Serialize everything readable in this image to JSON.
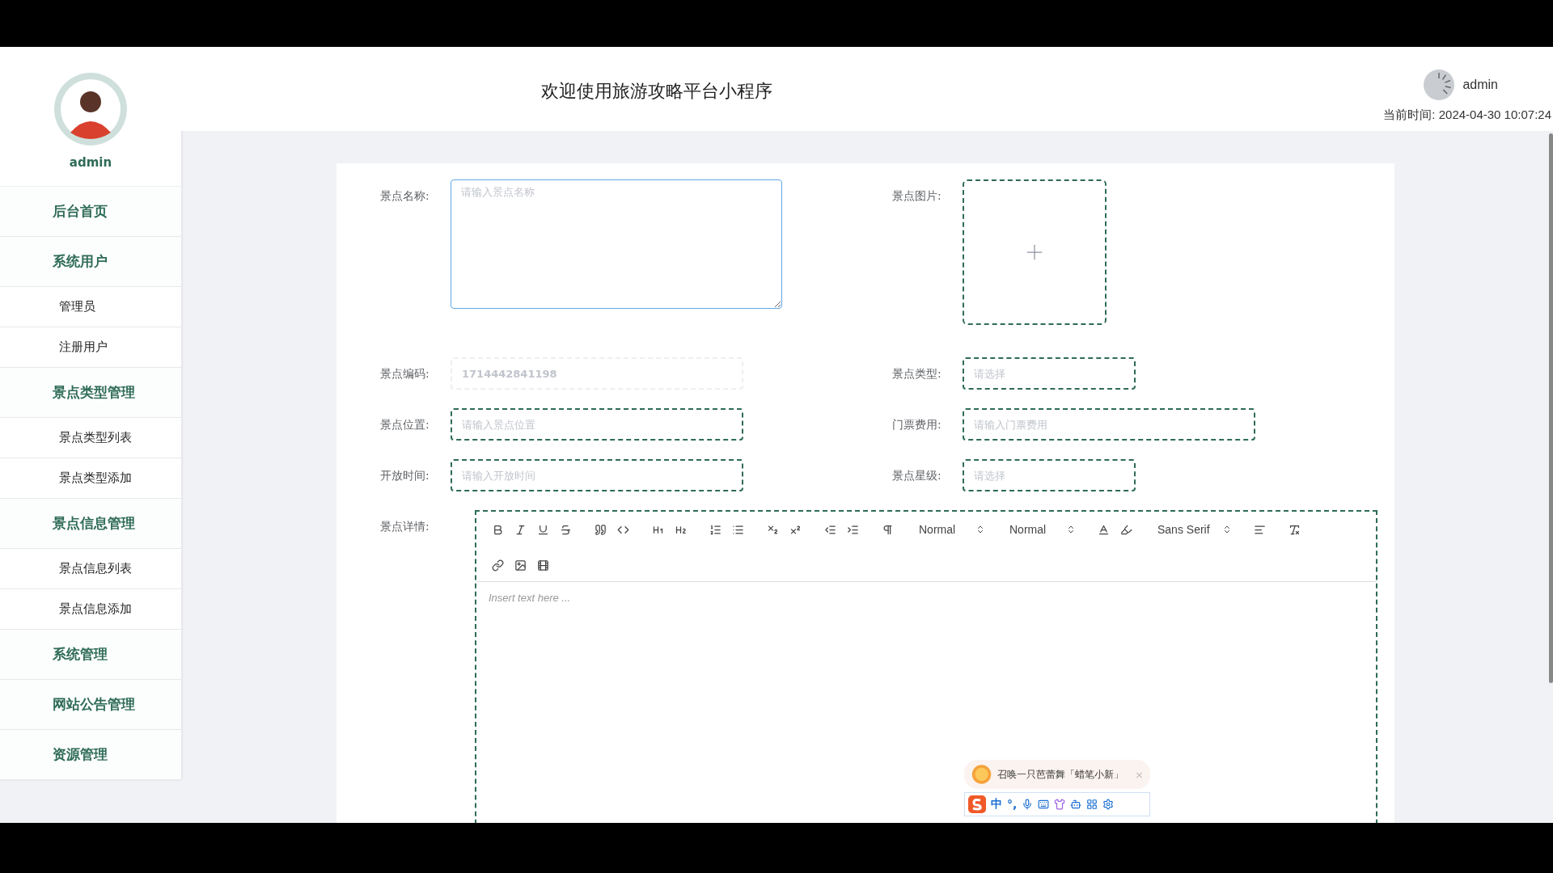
{
  "sidebar": {
    "username": "admin",
    "items": [
      {
        "label": "后台首页",
        "kind": "group"
      },
      {
        "label": "系统用户",
        "kind": "group"
      },
      {
        "label": "管理员",
        "kind": "sub"
      },
      {
        "label": "注册用户",
        "kind": "sub"
      },
      {
        "label": "景点类型管理",
        "kind": "group"
      },
      {
        "label": "景点类型列表",
        "kind": "sub"
      },
      {
        "label": "景点类型添加",
        "kind": "sub"
      },
      {
        "label": "景点信息管理",
        "kind": "group"
      },
      {
        "label": "景点信息列表",
        "kind": "sub"
      },
      {
        "label": "景点信息添加",
        "kind": "sub"
      },
      {
        "label": "系统管理",
        "kind": "group"
      },
      {
        "label": "网站公告管理",
        "kind": "group"
      },
      {
        "label": "资源管理",
        "kind": "group"
      }
    ]
  },
  "header": {
    "title": "欢迎使用旅游攻略平台小程序",
    "user": "admin",
    "time_label": "当前时间:",
    "time": "2024-04-30 10:07:24"
  },
  "form": {
    "fields": [
      {
        "label": "景点名称:",
        "kind": "textarea",
        "placeholder": "请输入景点名称",
        "focused": true
      },
      {
        "label": "景点图片:",
        "kind": "upload"
      },
      {
        "label": "景点编码:",
        "kind": "input",
        "value": "1714442841198",
        "disabled": true
      },
      {
        "label": "景点类型:",
        "kind": "select",
        "placeholder": "请选择"
      },
      {
        "label": "景点位置:",
        "kind": "input",
        "placeholder": "请输入景点位置"
      },
      {
        "label": "门票费用:",
        "kind": "input",
        "placeholder": "请输入门票费用"
      },
      {
        "label": "开放时间:",
        "kind": "input",
        "placeholder": "请输入开放时间"
      },
      {
        "label": "景点星级:",
        "kind": "select",
        "placeholder": "请选择"
      }
    ],
    "editor": {
      "label": "景点详情:",
      "header_select": "Normal",
      "size_select": "Normal",
      "font_select": "Sans Serif",
      "placeholder": "Insert text here ..."
    }
  },
  "ime": {
    "tip": "召唤一只芭蕾舞「蜡笔小新」",
    "close": "×",
    "mode": "中",
    "punct": "°,"
  }
}
